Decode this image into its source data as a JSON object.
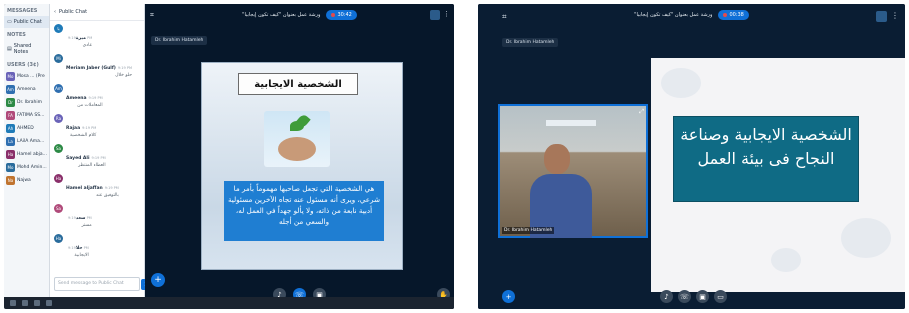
{
  "left": {
    "sidebar": {
      "messages_heading": "MESSAGES",
      "public_chat": "Public Chat",
      "notes_heading": "NOTES",
      "shared_notes": "Shared Notes",
      "users_heading": "USERS (3¢)",
      "users": [
        {
          "initials": "Mo",
          "name": "Mosa ... (Pre",
          "color": "#6a63b8"
        },
        {
          "initials": "Am",
          "name": "Ameena",
          "color": "#2f6fb0"
        },
        {
          "initials": "Dr",
          "name": "Dr. Ibrahim",
          "color": "#2d8a46"
        },
        {
          "initials": "FA",
          "name": "FATIMA SS...",
          "color": "#b04a7a"
        },
        {
          "initials": "Ah",
          "name": "AHMED",
          "color": "#1f7bb8"
        },
        {
          "initials": "La",
          "name": "LAilA Ama...",
          "color": "#2f6fb0"
        },
        {
          "initials": "Ha",
          "name": "Hamel abja...",
          "color": "#8a2f6a"
        },
        {
          "initials": "Mo",
          "name": "Mohd Amin...",
          "color": "#2a6c9c"
        },
        {
          "initials": "Na",
          "name": "Najwa",
          "color": "#c0742f"
        }
      ]
    },
    "chat": {
      "header": "Public Chat",
      "messages": [
        {
          "initials": "يا",
          "name": "ميرة",
          "time": "9:19 PM",
          "text": "عادي",
          "color": "#1f7bb8"
        },
        {
          "initials": "Mi",
          "name": "Meriam Jaber (Gulf)",
          "time": "9:19 PM",
          "text": "حلو خلال",
          "color": "#2a6c9c"
        },
        {
          "initials": "Am",
          "name": "Ameena",
          "time": "9:19 PM",
          "text": "المعاملات من",
          "color": "#2f6fb0"
        },
        {
          "initials": "Ra",
          "name": "Rajaa",
          "time": "9:19 PM",
          "text": "كلام الشخصية",
          "color": "#6a63b8"
        },
        {
          "initials": "Sa",
          "name": "Sayed Ali",
          "time": "9:19 PM",
          "text": "العطاء المنتظر",
          "color": "#2d8a46"
        },
        {
          "initials": "Ha",
          "name": "Hamel aljaffan",
          "time": "9:19 PM",
          "text": "بالتوفيق عند",
          "color": "#8a2f6a"
        },
        {
          "initials": "Sa",
          "name": "سعد",
          "time": "9:19 PM",
          "text": "مستر",
          "color": "#b04a7a"
        },
        {
          "initials": "Ha",
          "name": "حلا",
          "time": "9:19 PM",
          "text": "الايجابية",
          "color": "#2a6c9c"
        }
      ],
      "input_placeholder": "Send message to Public Chat",
      "send_icon": "➤"
    },
    "stage": {
      "meeting_title": "ورشة عمل بعنوان \"كيف تكون إيجابيا\"",
      "record_time": "30:42",
      "presenter_label": "Dr. Ibrahim Hatamleh",
      "slide_title": "الشخصية الايجابية",
      "slide_text": "هي الشخصية التي تجعل صاحبها مهموماً بأمر ما شرعي، ويرى أنه مسئول عنه تجاه الآخرين مسئولية أدبية نابعة من ذاته، ولا يألو جهداً في العمل له، والسعي من أجله",
      "plus_icon": "+",
      "colors": {
        "accent": "#0f70d7",
        "stage": "#06172a"
      }
    }
  },
  "right": {
    "stage": {
      "meeting_title": "ورشة عمل بعنوان \"كيف تكون إيجابيا\"",
      "record_time": "00:38",
      "presenter_label": "Dr. Ibrahim Hatamleh",
      "webcam_name": "Dr. Ibrahim Hatamleh",
      "slide_title": "الشخصية الايجابية وصناعة النجاح فى بيئة العمل"
    }
  }
}
